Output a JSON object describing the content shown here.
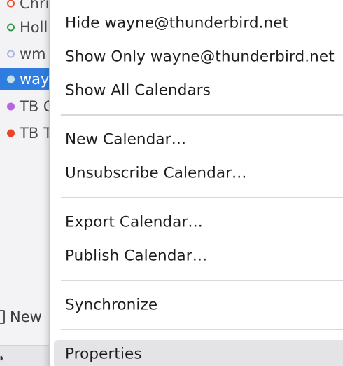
{
  "calendar_list": {
    "items": [
      {
        "label": "Chris",
        "color": "#e8552f",
        "style": "ring",
        "selected": false
      },
      {
        "label": "Holl",
        "color": "#2e9b4d",
        "style": "ring",
        "selected": false
      },
      {
        "label": "wm",
        "color": "#a9b4e8",
        "style": "ring",
        "selected": false
      },
      {
        "label": "way",
        "color": "#bfe3e8",
        "style": "fill",
        "selected": true
      },
      {
        "label": "TB C",
        "color": "#b765e6",
        "style": "fill",
        "selected": false
      },
      {
        "label": "TB T",
        "color": "#e8452a",
        "style": "fill",
        "selected": false
      }
    ],
    "new_calendar_label": "New",
    "new_calendar_icon": "document-icon",
    "status_icon": "wifi-icon"
  },
  "context_menu": {
    "items": [
      {
        "label": "Hide wayne@thunderbird.net"
      },
      {
        "label": "Show Only wayne@thunderbird.net"
      },
      {
        "label": "Show All Calendars"
      },
      {
        "label": "New Calendar…"
      },
      {
        "label": "Unsubscribe Calendar…"
      },
      {
        "label": "Export Calendar…"
      },
      {
        "label": "Publish Calendar…"
      },
      {
        "label": "Synchronize"
      },
      {
        "label": "Properties",
        "highlighted": true
      }
    ]
  },
  "colors": {
    "selection_blue": "#2f7de1",
    "menu_background": "#ffffff",
    "menu_highlight": "#e4e4e6",
    "separator": "#d9d9dc"
  }
}
